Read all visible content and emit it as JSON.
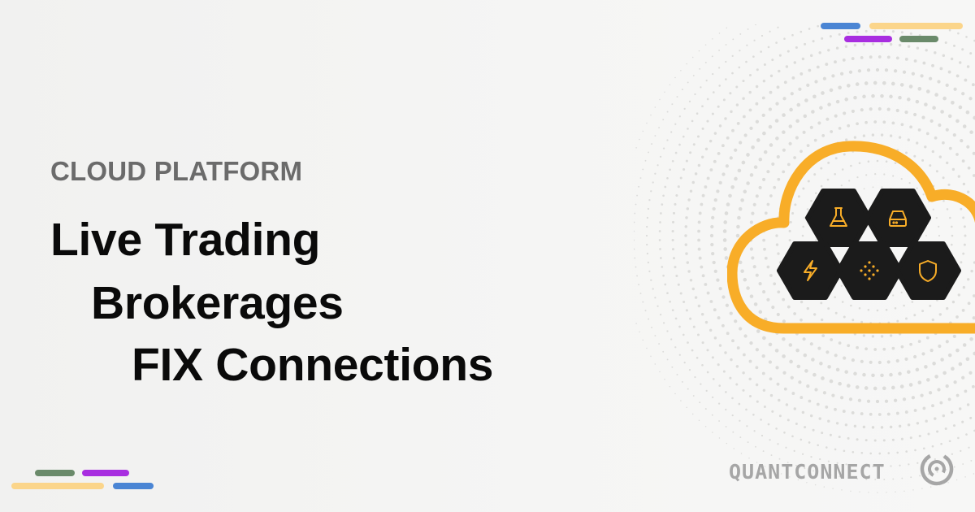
{
  "eyebrow": "CLOUD PLATFORM",
  "headline": {
    "line1": "Live Trading",
    "line2": "Brokerages",
    "line3": "FIX Connections"
  },
  "brand": {
    "name": "QUANTCONNECT"
  },
  "colors": {
    "background": "#f4f4f3",
    "accent_orange": "#f8ad28",
    "hex_fill": "#1b1b1b",
    "stripe_blue": "#4a85d4",
    "stripe_yellow": "#fbd58a",
    "stripe_purple": "#a82ee0",
    "stripe_green": "#6a8a6a",
    "logo_gray": "#a6a6a6"
  },
  "cloud_icons": [
    "flask-icon",
    "server-icon",
    "lightning-icon",
    "dots-grid-icon",
    "shield-icon"
  ]
}
